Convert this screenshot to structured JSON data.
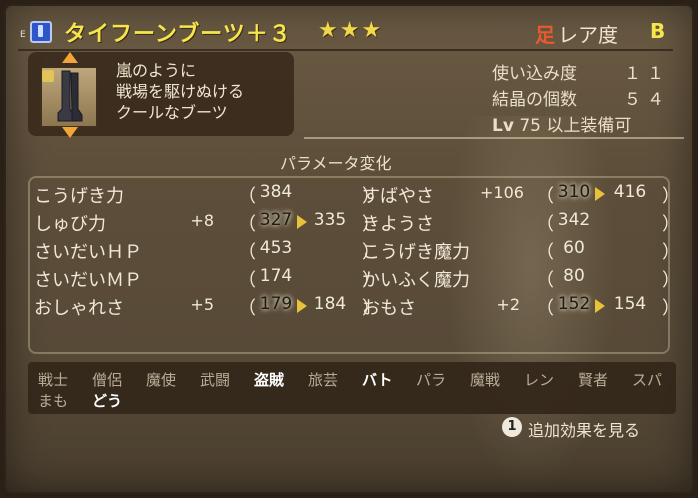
{
  "header": {
    "slot_tag": "E",
    "item_name": "タイフーンブーツ＋３",
    "stars": "★★★",
    "slot_char": "足",
    "rarity_label": "レア度",
    "rarity_value": "B"
  },
  "item": {
    "description": [
      "嵐のように",
      "戦場を駆けぬける",
      "クールなブーツ"
    ],
    "icon": "boots-icon",
    "locked": true
  },
  "info": {
    "usage_label": "使い込み度",
    "usage_value": "１１",
    "crystal_label": "結晶の個数",
    "crystal_value": "５４",
    "lv_key": "Lv",
    "lv_value": "75",
    "lv_suffix": "以上装備可"
  },
  "params_title": "パラメータ変化",
  "params_left": [
    {
      "name": "こうげき力",
      "mod": "",
      "base": "384",
      "new": "",
      "changed": false
    },
    {
      "name": "しゅび力",
      "mod": "+8",
      "base": "327",
      "new": "335",
      "changed": true
    },
    {
      "name": "さいだいＨＰ",
      "mod": "",
      "base": "453",
      "new": "",
      "changed": false
    },
    {
      "name": "さいだいＭＰ",
      "mod": "",
      "base": "174",
      "new": "",
      "changed": false
    },
    {
      "name": "おしゃれさ",
      "mod": "+5",
      "base": "179",
      "new": "184",
      "changed": true
    }
  ],
  "params_right": [
    {
      "name": "すばやさ",
      "mod": "+106",
      "base": "310",
      "new": "416",
      "changed": true
    },
    {
      "name": "きようさ",
      "mod": "",
      "base": "342",
      "new": "",
      "changed": false
    },
    {
      "name": "こうげき魔力",
      "mod": "",
      "base": "60",
      "new": "",
      "changed": false
    },
    {
      "name": "かいふく魔力",
      "mod": "",
      "base": "80",
      "new": "",
      "changed": false
    },
    {
      "name": "おもさ",
      "mod": "+2",
      "base": "152",
      "new": "154",
      "changed": true
    }
  ],
  "paren_open": "（",
  "paren_close": "）",
  "jobs_row1": [
    {
      "label": "戦士",
      "on": false
    },
    {
      "label": "僧侶",
      "on": false
    },
    {
      "label": "魔使",
      "on": false
    },
    {
      "label": "武闘",
      "on": false
    },
    {
      "label": "盗賊",
      "on": true
    },
    {
      "label": "旅芸",
      "on": false
    },
    {
      "label": "バト",
      "on": true
    },
    {
      "label": "パラ",
      "on": false
    },
    {
      "label": "魔戦",
      "on": false
    },
    {
      "label": "レン",
      "on": false
    },
    {
      "label": "賢者",
      "on": false
    },
    {
      "label": "スパ",
      "on": false
    }
  ],
  "jobs_row2": [
    {
      "label": "まも",
      "on": false
    },
    {
      "label": "どう",
      "on": true
    }
  ],
  "hint": {
    "button": "1",
    "label": "追加効果を見る"
  },
  "colors": {
    "title": "#f4e64c",
    "slot_char": "#e85a2c",
    "arrow": "#e8c23a",
    "job_on": "#ffffff",
    "job_off": "#b8ad96"
  }
}
